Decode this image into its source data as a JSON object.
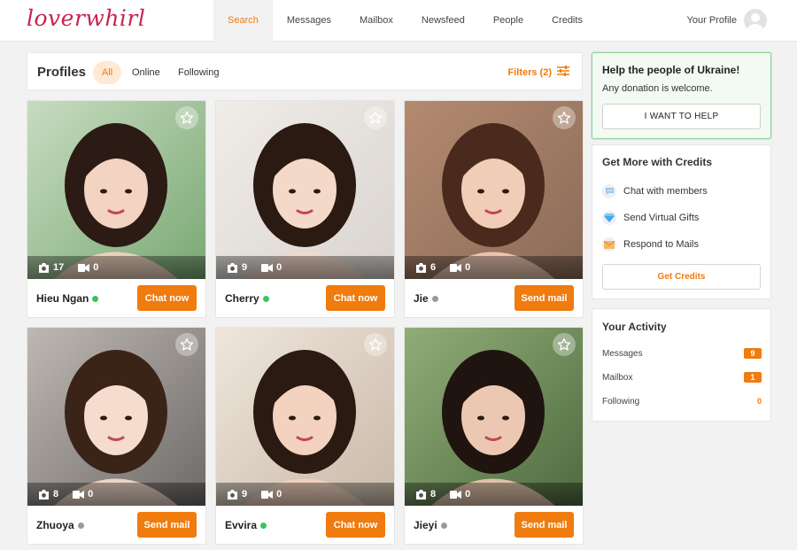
{
  "brand": {
    "logo_text": "loverwhirl",
    "accent": "#f07b0f",
    "logo_color": "#c8244f",
    "online_color": "#3cc35c"
  },
  "nav": {
    "items": [
      {
        "label": "Search",
        "active": true
      },
      {
        "label": "Messages"
      },
      {
        "label": "Mailbox"
      },
      {
        "label": "Newsfeed"
      },
      {
        "label": "People"
      },
      {
        "label": "Credits"
      }
    ],
    "profile_label": "Your Profile"
  },
  "profiles": {
    "title": "Profiles",
    "tabs": [
      "All",
      "Online",
      "Following"
    ],
    "active_tab": "All",
    "filters_label": "Filters (2)"
  },
  "cards": [
    {
      "name": "Hieu Ngan",
      "online": true,
      "photos": "17",
      "videos": "0",
      "action": "Chat now"
    },
    {
      "name": "Cherry",
      "online": true,
      "photos": "9",
      "videos": "0",
      "action": "Chat now"
    },
    {
      "name": "Jie",
      "online": false,
      "photos": "6",
      "videos": "0",
      "action": "Send mail"
    },
    {
      "name": "Zhuoya",
      "online": false,
      "photos": "8",
      "videos": "0",
      "action": "Send mail"
    },
    {
      "name": "Evvira",
      "online": true,
      "photos": "9",
      "videos": "0",
      "action": "Chat now"
    },
    {
      "name": "Jieyi",
      "online": false,
      "photos": "8",
      "videos": "0",
      "action": "Send mail"
    }
  ],
  "ukraine": {
    "title": "Help the people of Ukraine!",
    "subtitle": "Any donation is welcome.",
    "button": "I WANT TO HELP"
  },
  "credits": {
    "title": "Get More with Credits",
    "items": [
      {
        "label": "Chat with members",
        "icon": "chat-icon"
      },
      {
        "label": "Send Virtual Gifts",
        "icon": "diamond-icon"
      },
      {
        "label": "Respond to Mails",
        "icon": "envelope-icon"
      }
    ],
    "button": "Get Credits"
  },
  "activity": {
    "title": "Your Activity",
    "rows": [
      {
        "label": "Messages",
        "count": "9"
      },
      {
        "label": "Mailbox",
        "count": "1"
      },
      {
        "label": "Following",
        "count": "0"
      }
    ]
  }
}
